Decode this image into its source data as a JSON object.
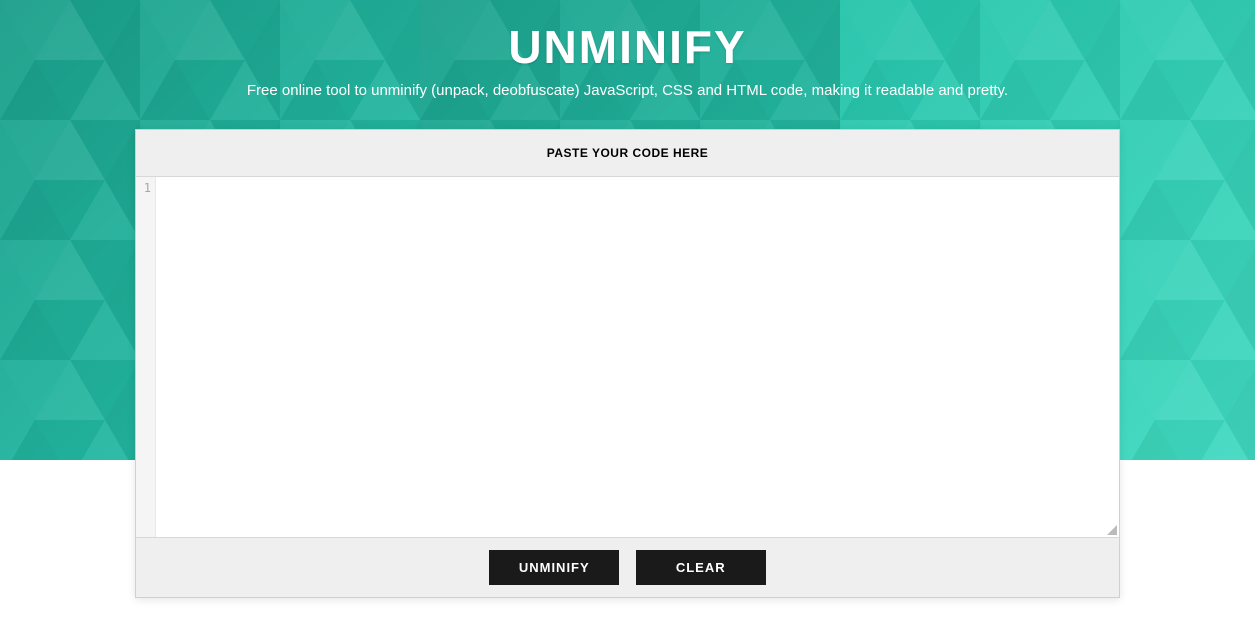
{
  "header": {
    "title": "UNMINIFY",
    "subtitle": "Free online tool to unminify (unpack, deobfuscate) JavaScript, CSS and HTML code, making it readable and pretty."
  },
  "editor": {
    "header_label": "PASTE YOUR CODE HERE",
    "line_number": "1",
    "code_value": ""
  },
  "actions": {
    "unminify_label": "UNMINIFY",
    "clear_label": "CLEAR"
  }
}
